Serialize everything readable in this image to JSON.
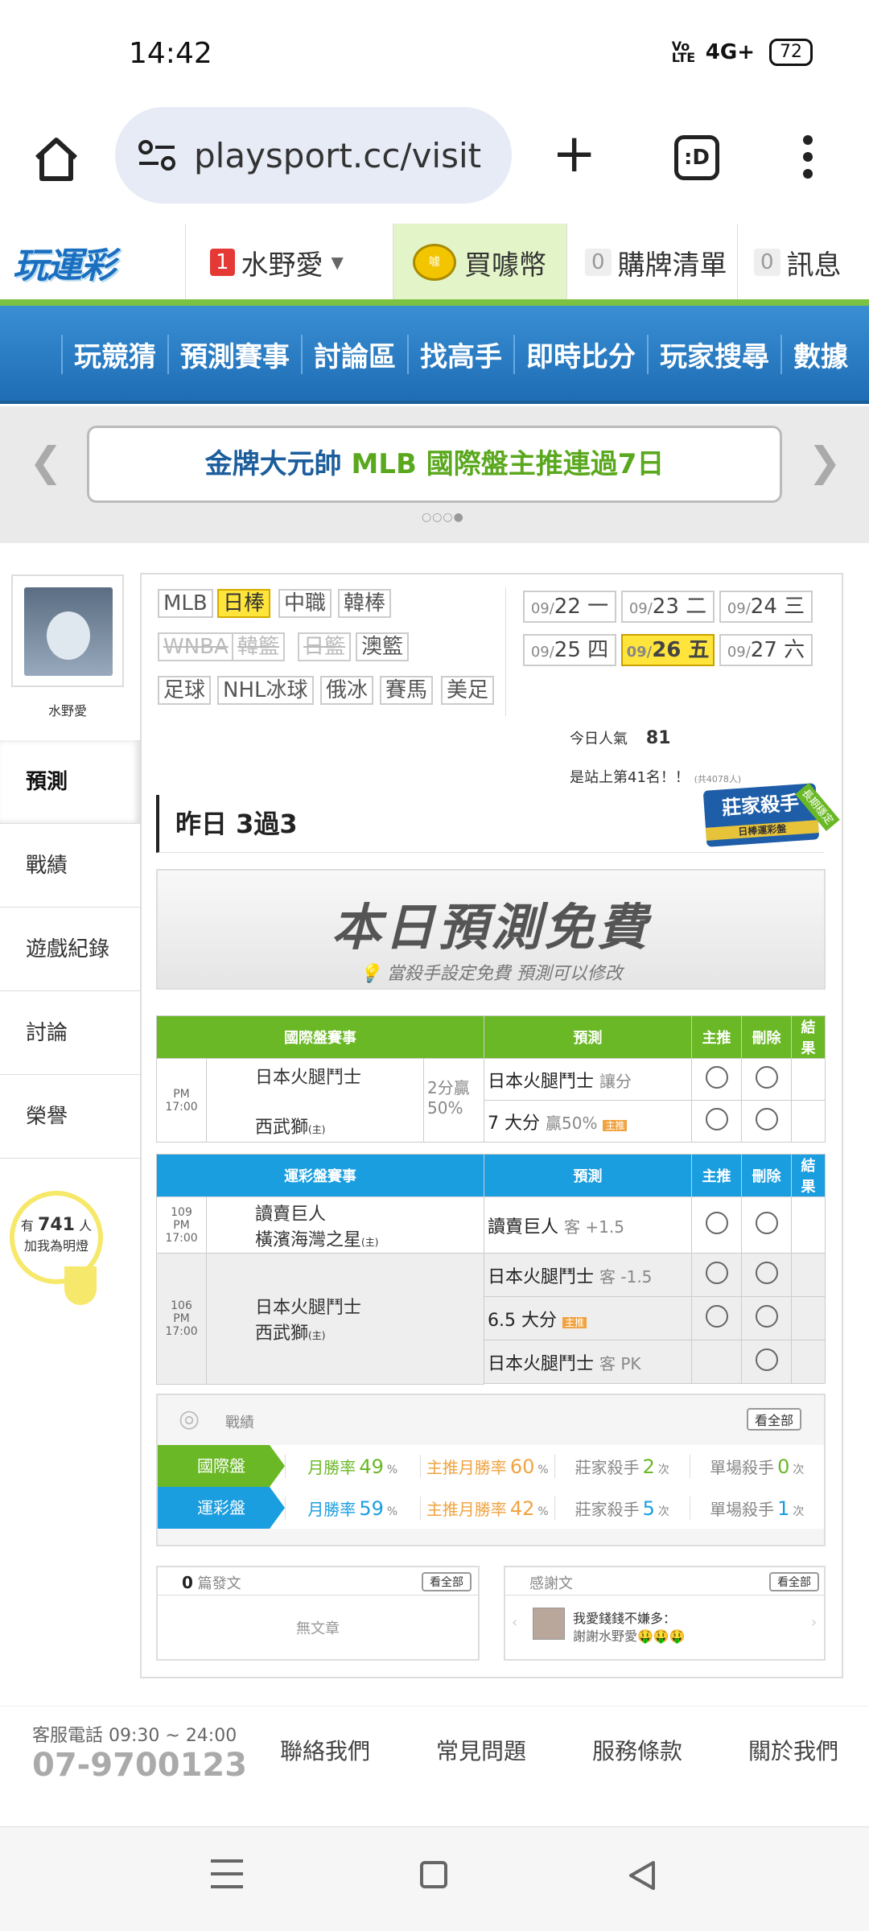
{
  "status": {
    "time": "14:42",
    "net": "4G+",
    "battery": "72",
    "volte": "Vo LTE"
  },
  "browser": {
    "url": "playsport.cc/visit",
    "tabs": ":D"
  },
  "header": {
    "logo": "玩運彩",
    "user_num": "1",
    "user": "水野愛",
    "buy": "買噱幣",
    "cart_num": "0",
    "cart": "購牌清單",
    "msg_num": "0",
    "msg": "訊息"
  },
  "nav": [
    "玩競猜",
    "預測賽事",
    "討論區",
    "找高手",
    "即時比分",
    "玩家搜尋",
    "數據"
  ],
  "banner": {
    "pre": "金牌大元帥 ",
    "mlb": "MLB 國際盤主推連過7日"
  },
  "profile": {
    "name": "水野愛"
  },
  "side": [
    "預測",
    "戰績",
    "遊戲紀錄",
    "討論",
    "榮譽"
  ],
  "bulb": {
    "pre": "有",
    "num": "741",
    "post": "人",
    "line2": "加我為明燈"
  },
  "leagues": [
    {
      "label": "MLB",
      "state": "n"
    },
    {
      "label": "日棒",
      "state": "sel"
    },
    {
      "label": "中職",
      "state": "n"
    },
    {
      "label": "韓棒",
      "state": "n"
    },
    {
      "label": "WNBA",
      "state": "dis"
    },
    {
      "label": "韓籃",
      "state": "dis"
    },
    {
      "label": "日籃",
      "state": "dis"
    },
    {
      "label": "澳籃",
      "state": "n"
    },
    {
      "label": "足球",
      "state": "n"
    },
    {
      "label": "NHL冰球",
      "state": "n"
    },
    {
      "label": "俄冰",
      "state": "n"
    },
    {
      "label": "賽馬",
      "state": "n"
    },
    {
      "label": "美足",
      "state": "n"
    }
  ],
  "dates": [
    {
      "m": "09/",
      "d": "22 一"
    },
    {
      "m": "09/",
      "d": "23 二"
    },
    {
      "m": "09/",
      "d": "24 三"
    },
    {
      "m": "09/",
      "d": "25 四"
    },
    {
      "m": "09/",
      "d": "26 五"
    },
    {
      "m": "09/",
      "d": "27 六"
    }
  ],
  "popularity": {
    "label": "今日人氣",
    "value": "81",
    "rank": "是站上第41名！！",
    "total": "(共4078人)"
  },
  "yesterday": "昨日 3過3",
  "killer": {
    "t1": "莊家殺手",
    "t2": "日棒運彩盤",
    "t3": "長期穩定"
  },
  "free": {
    "title": "本日預測免費",
    "sub": "當殺手設定免費 預測可以修改"
  },
  "intl": {
    "headers": [
      "國際盤賽事",
      "預測",
      "主推",
      "刪除",
      "結果"
    ],
    "time": "PM 17:00",
    "team1": "日本火腿鬥士",
    "team2": "西武獅",
    "home": "(主)",
    "line": "2分贏",
    "pct": "50%",
    "p1": "日本火腿鬥士",
    "p1s": "讓分",
    "p2": "7 大分",
    "p2s": "贏50%",
    "tag": "主推"
  },
  "sport": {
    "headers": [
      "運彩盤賽事",
      "預測",
      "主推",
      "刪除",
      "結果"
    ],
    "g1": {
      "num": "109",
      "time": "PM 17:00",
      "team1": "讀賣巨人",
      "team2": "橫濱海灣之星",
      "home": "(主)",
      "pred": "讀賣巨人",
      "s": "客 +1.5"
    },
    "g2": {
      "num": "106",
      "time": "PM 17:00",
      "team1": "日本火腿鬥士",
      "team2": "西武獅",
      "home": "(主)",
      "preds": [
        {
          "t": "日本火腿鬥士",
          "s": "客 -1.5"
        },
        {
          "t": "6.5 大分",
          "s": ""
        },
        {
          "t": "日本火腿鬥士",
          "s": "客 PK"
        }
      ],
      "tag": "主推"
    }
  },
  "stats": {
    "title": "戰績",
    "more": "看全部",
    "rows": [
      {
        "label": "國際盤",
        "a_l": "月勝率",
        "a": "49",
        "b_l": "主推月勝率",
        "b": "60",
        "c_l": "莊家殺手",
        "c": "2",
        "d_l": "單場殺手",
        "d": "0",
        "color": "#6ab825"
      },
      {
        "label": "運彩盤",
        "a_l": "月勝率",
        "a": "59",
        "b_l": "主推月勝率",
        "b": "42",
        "c_l": "莊家殺手",
        "c": "5",
        "d_l": "單場殺手",
        "d": "1",
        "color": "#1a9ee0"
      }
    ],
    "pct": "%",
    "times": "次"
  },
  "posts": {
    "count": "0",
    "label": "篇發文",
    "more": "看全部",
    "empty": "無文章"
  },
  "thanks": {
    "label": "感謝文",
    "more": "看全部",
    "l1": "我愛錢錢不嫌多：",
    "l2": "謝謝水野愛🤑🤑🤑"
  },
  "footer": {
    "hours": "客服電話 09:30 ~ 24:00",
    "phone": "07-9700123",
    "links": [
      "聯絡我們",
      "常見問題",
      "服務條款",
      "關於我們"
    ]
  },
  "colors": {
    "green": "#6ab825",
    "blue": "#1a9ee0",
    "yellow": "#ffe53b",
    "navBlue": "#1e6db5"
  }
}
